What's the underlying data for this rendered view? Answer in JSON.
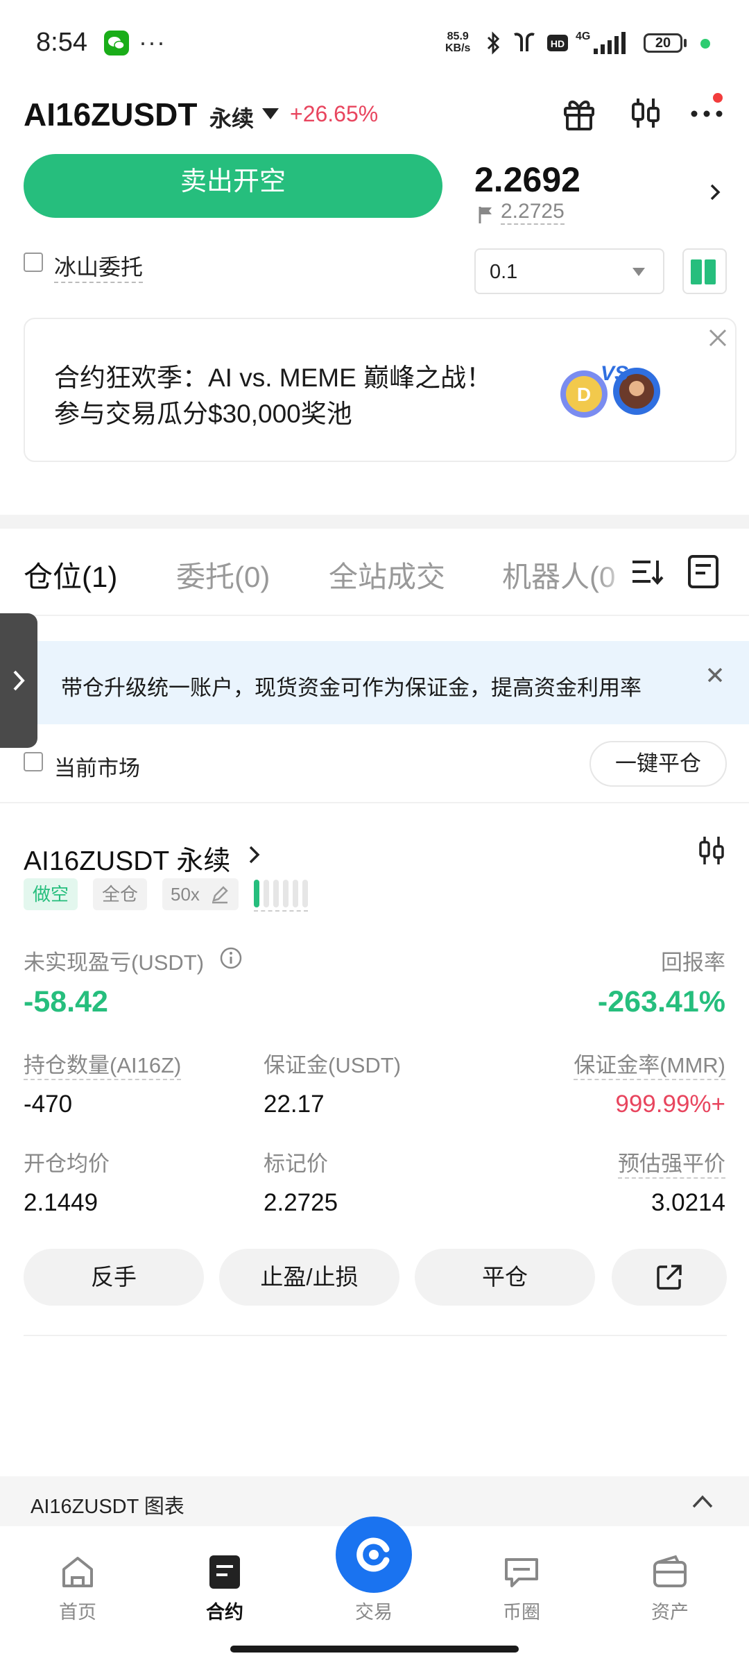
{
  "status_bar": {
    "time": "8:54",
    "net_speed_top": "85.9",
    "net_speed_bottom": "KB/s",
    "network": "4G",
    "battery": "20"
  },
  "header": {
    "pair": "AI16ZUSDT",
    "contract_type": "永续",
    "change": "+26.65%"
  },
  "trade": {
    "sell_button": "卖出开空",
    "last_price": "2.2692",
    "mark_price": "2.2725",
    "iceberg_label": "冰山委托",
    "quantity": "0.1"
  },
  "promo": {
    "line1": "合约狂欢季：AI vs. MEME 巅峰之战！",
    "line2": "参与交易瓜分$30,000奖池",
    "art_text": "VS"
  },
  "tabs": [
    {
      "label": "仓位(1)"
    },
    {
      "label": "委托(0)"
    },
    {
      "label": "全站成交"
    },
    {
      "label": "机器人(0"
    }
  ],
  "notice": {
    "text": "带仓升级统一账户，现货资金可作为保证金，提高资金利用率"
  },
  "filter": {
    "current_market": "当前市场",
    "close_all": "一键平仓"
  },
  "position": {
    "title": "AI16ZUSDT 永续",
    "side": "做空",
    "margin_mode": "全仓",
    "leverage": "50x",
    "unrealized_pnl_label": "未实现盈亏(USDT)",
    "unrealized_pnl": "-58.42",
    "roi_label": "回报率",
    "roi": "-263.41%",
    "size_label": "持仓数量(AI16Z)",
    "size": "-470",
    "margin_label": "保证金(USDT)",
    "margin": "22.17",
    "mmr_label": "保证金率(MMR)",
    "mmr": "999.99%+",
    "entry_label": "开仓均价",
    "entry": "2.1449",
    "mark_label": "标记价",
    "mark": "2.2725",
    "liq_label": "预估强平价",
    "liq": "3.0214",
    "actions": {
      "reverse": "反手",
      "tpsl": "止盈/止损",
      "close": "平仓"
    }
  },
  "chart_section": {
    "label": "AI16ZUSDT 图表"
  },
  "bottom_nav": [
    {
      "label": "首页",
      "icon": "home-icon"
    },
    {
      "label": "合约",
      "icon": "contract-icon"
    },
    {
      "label": "交易",
      "icon": "trade-icon"
    },
    {
      "label": "币圈",
      "icon": "community-icon"
    },
    {
      "label": "资产",
      "icon": "wallet-icon"
    }
  ],
  "colors": {
    "green": "#26be7d",
    "red": "#e8455e",
    "blue": "#1a73f0",
    "notice_bg": "#eaf4fd"
  }
}
